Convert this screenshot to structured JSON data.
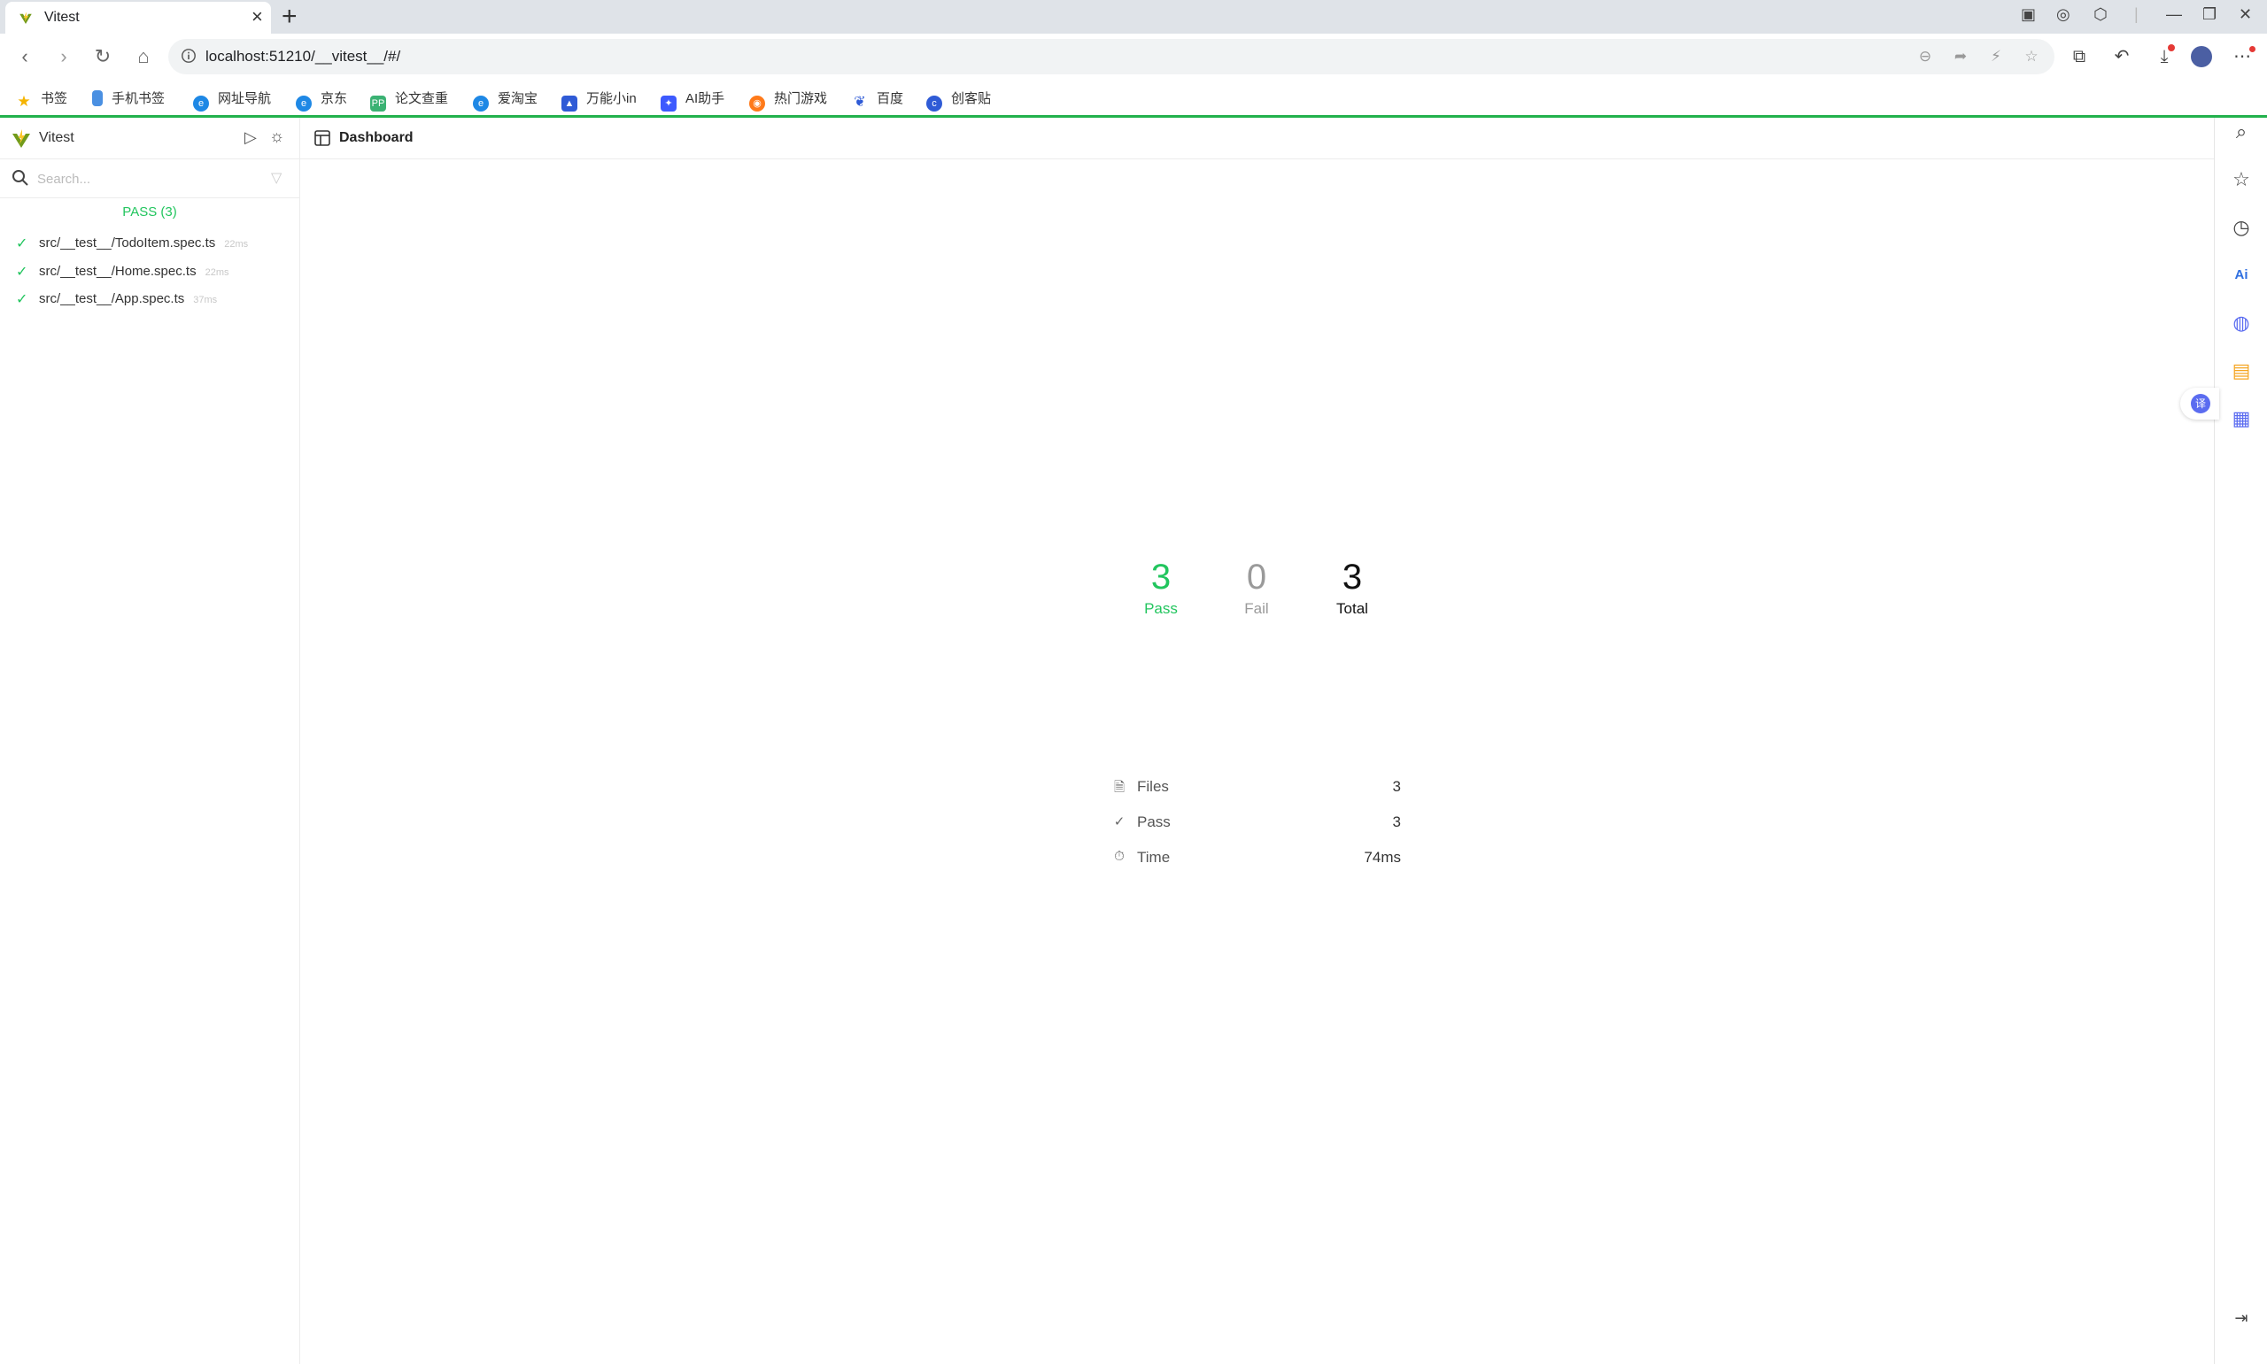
{
  "browser": {
    "tab_title": "Vitest",
    "url": "localhost:51210/__vitest__/#/",
    "bookmarks": [
      "书签",
      "手机书签",
      "网址导航",
      "京东",
      "论文查重",
      "爱淘宝",
      "万能小in",
      "AI助手",
      "热门游戏",
      "百度",
      "创客贴"
    ],
    "colors": {
      "tabbar": "#dfe3e8",
      "accent_line": "#22b14c"
    }
  },
  "sidebar": {
    "title": "Vitest",
    "search_placeholder": "Search...",
    "pass_group_label": "PASS (3)",
    "files": [
      {
        "name": "src/__test__/TodoItem.spec.ts",
        "duration": "22ms"
      },
      {
        "name": "src/__test__/Home.spec.ts",
        "duration": "22ms"
      },
      {
        "name": "src/__test__/App.spec.ts",
        "duration": "37ms"
      }
    ]
  },
  "main": {
    "header_title": "Dashboard",
    "summary": {
      "pass_count": "3",
      "pass_label": "Pass",
      "fail_count": "0",
      "fail_label": "Fail",
      "total_count": "3",
      "total_label": "Total"
    },
    "stats": {
      "files_label": "Files",
      "files_value": "3",
      "pass_label": "Pass",
      "pass_value": "3",
      "time_label": "Time",
      "time_value": "74ms"
    },
    "colors": {
      "pass": "#22c55e",
      "fail": "#aaaaaa",
      "total": "#111111"
    }
  }
}
